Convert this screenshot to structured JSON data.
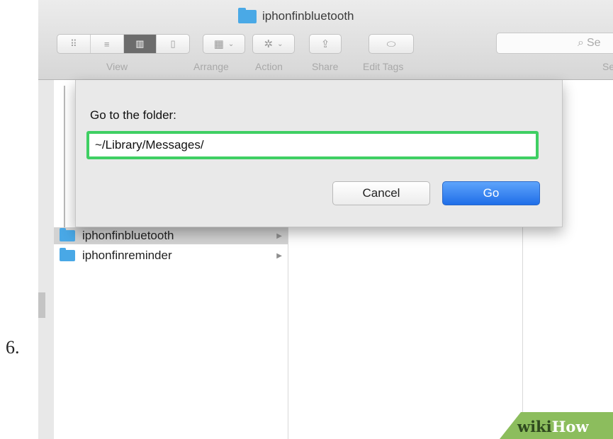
{
  "step_number": "6.",
  "window": {
    "title": "iphonfinbluetooth",
    "toolbar": {
      "view_label": "View",
      "arrange_label": "Arrange",
      "action_label": "Action",
      "share_label": "Share",
      "edit_tags_label": "Edit Tags",
      "search_placeholder": "Se",
      "search_label": "Se"
    },
    "view_modes": [
      "icon-view-icon",
      "list-view-icon",
      "column-view-icon",
      "cover-flow-icon"
    ],
    "active_view_mode": "column-view-icon"
  },
  "dialog": {
    "label": "Go to the folder:",
    "input_value": "~/Library/Messages/",
    "cancel_label": "Cancel",
    "go_label": "Go",
    "input_border_color": "#3fcf63",
    "go_color": "#1f6ee8"
  },
  "files": [
    {
      "name": "iphonfinbluetooth",
      "selected": true
    },
    {
      "name": "iphonfinreminder",
      "selected": false
    }
  ],
  "watermark": {
    "part1": "wiki",
    "part2": "How"
  }
}
